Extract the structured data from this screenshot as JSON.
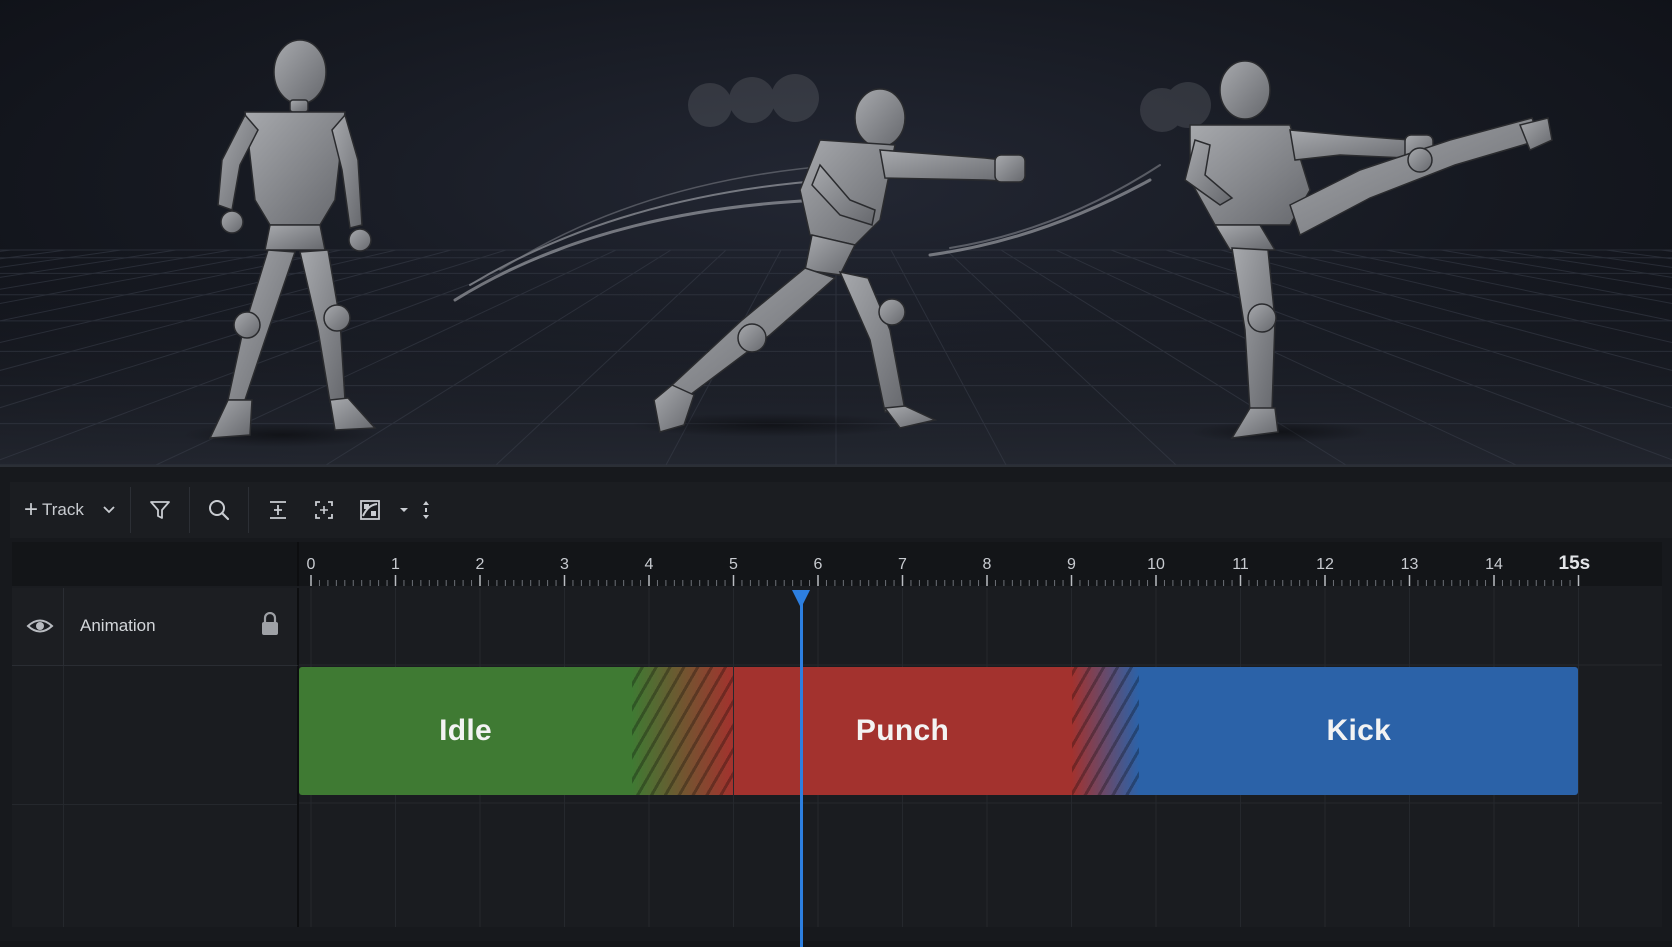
{
  "toolbar": {
    "add_track_label": "Track",
    "icons": [
      "plus-icon",
      "chevron-down-icon",
      "filter-icon",
      "search-icon",
      "fit-vertical-icon",
      "fit-frame-icon",
      "curve-editor-icon",
      "caret-down-icon",
      "expand-vertical-icon"
    ]
  },
  "timeline": {
    "unit": "s",
    "tick_labels": [
      "0",
      "1",
      "2",
      "3",
      "4",
      "5",
      "6",
      "7",
      "8",
      "9",
      "10",
      "11",
      "12",
      "13",
      "14",
      "15s"
    ],
    "end": 15,
    "playhead": 5.8,
    "colors": {
      "playhead": "#2d7fe0",
      "idle": "#3f7a33",
      "punch": "#a3322e",
      "kick": "#2b62a8"
    }
  },
  "track": {
    "name": "Animation",
    "visible": true,
    "locked": true
  },
  "clips": [
    {
      "label": "Idle",
      "start": 0,
      "end": 5.0
    },
    {
      "label": "Punch",
      "start": 3.8,
      "end": 9.8
    },
    {
      "label": "Kick",
      "start": 9.0,
      "end": 15
    }
  ]
}
